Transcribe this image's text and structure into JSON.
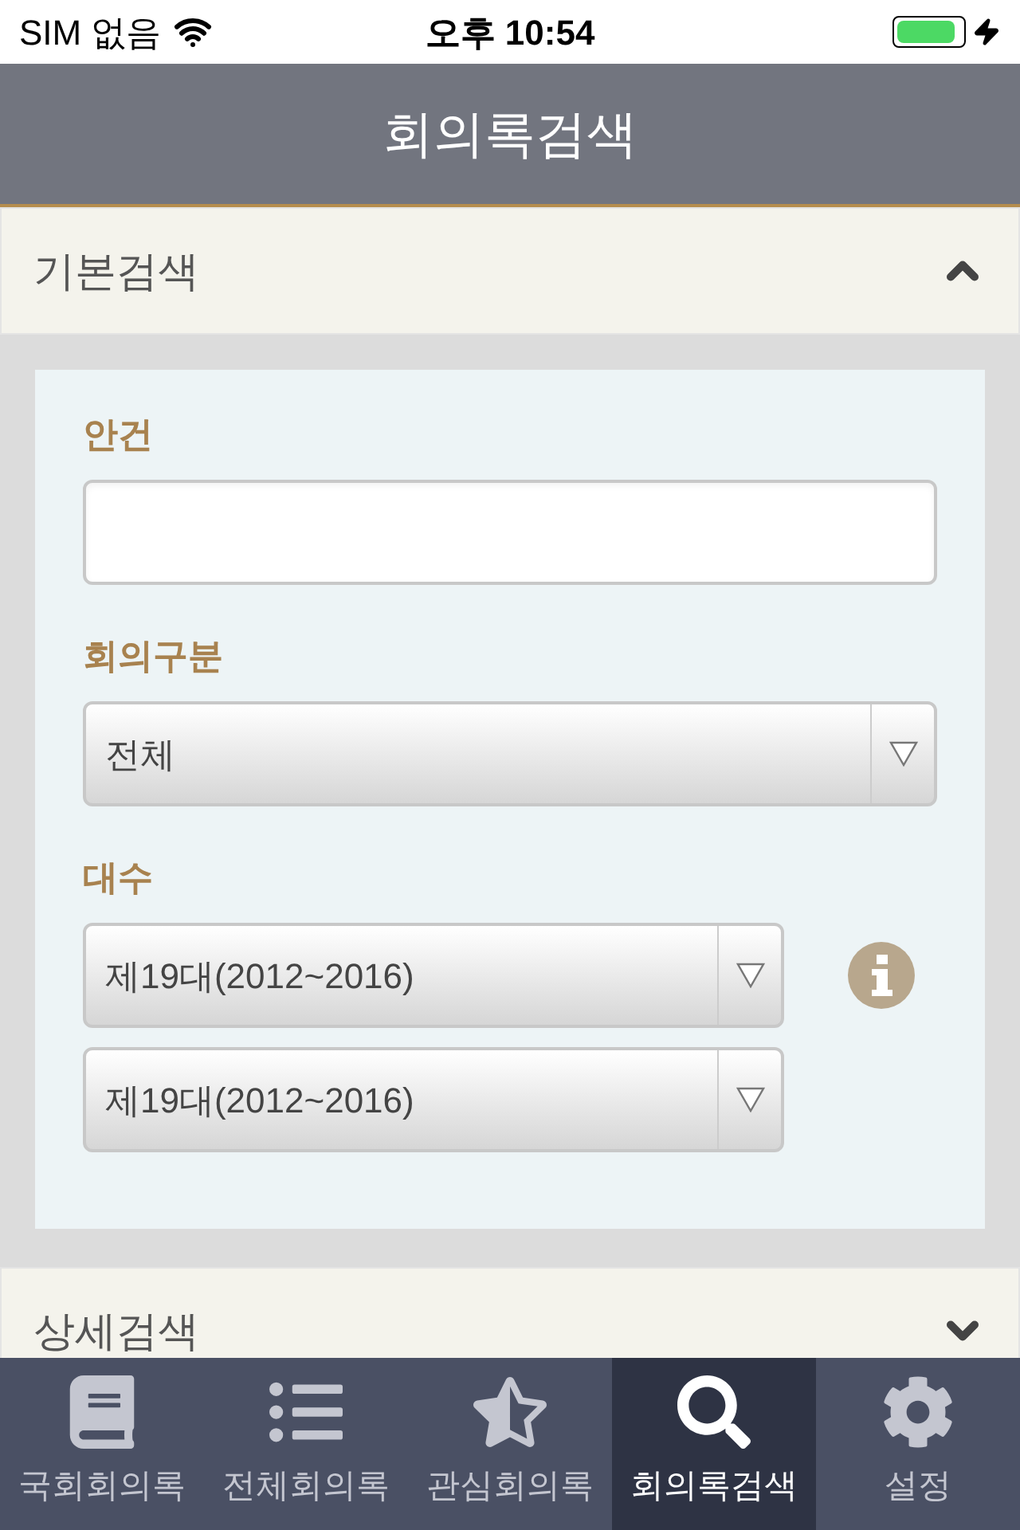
{
  "status_bar": {
    "carrier": "SIM 없음",
    "time": "오후 10:54",
    "battery": {
      "level": 0.9
    }
  },
  "nav": {
    "title": "회의록검색"
  },
  "sections": [
    {
      "title": "기본검색",
      "expanded": true,
      "fields": [
        {
          "kind": "text",
          "label": "안건"
        },
        {
          "kind": "select",
          "label": "회의구분",
          "values": [
            "전체"
          ]
        },
        {
          "kind": "select",
          "label": "대수",
          "values": [
            "제19대(2012~2016)",
            "제19대(2012~2016)"
          ],
          "info": true
        }
      ]
    },
    {
      "title": "상세검색",
      "expanded": false
    }
  ],
  "tabs": [
    {
      "kind": "book",
      "label": "국회회의록",
      "selected": false
    },
    {
      "kind": "list",
      "label": "전체회의록",
      "selected": false
    },
    {
      "kind": "star",
      "label": "관심회의록",
      "selected": false
    },
    {
      "kind": "search",
      "label": "회의록검색",
      "selected": true
    },
    {
      "kind": "gear",
      "label": "설정",
      "selected": false
    }
  ]
}
